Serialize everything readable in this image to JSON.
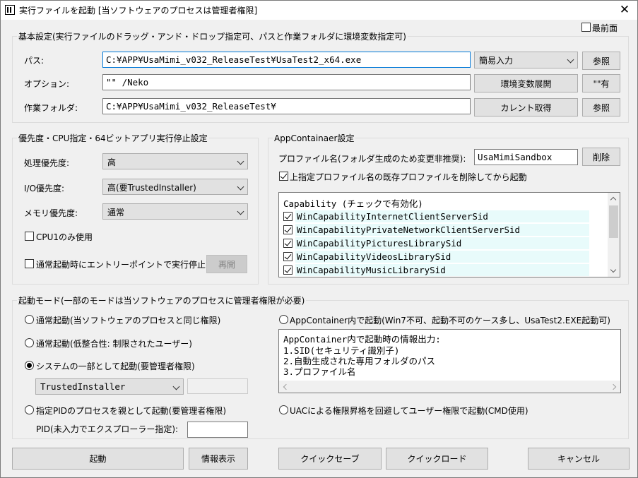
{
  "window": {
    "title": "実行ファイルを起動 [当ソフトウェアのプロセスは管理者権限]",
    "close_glyph": "✕"
  },
  "topmost": {
    "label": "最前面",
    "checked": false
  },
  "basic": {
    "title": "基本設定(実行ファイルのドラッグ・アンド・ドロップ指定可、パスと作業フォルダに環境変数指定可)",
    "path_label": "パス:",
    "path_value": "C:¥APP¥UsaMimi_v032_ReleaseTest¥UsaTest2_x64.exe",
    "input_mode": "簡易入力",
    "browse1": "参照",
    "option_label": "オプション:",
    "option_value": "\"\" /Neko",
    "expand_env": "環境変数展開",
    "quote_button": "\"\"有",
    "workdir_label": "作業フォルダ:",
    "workdir_value": "C:¥APP¥UsaMimi_v032_ReleaseTest¥",
    "get_current": "カレント取得",
    "browse2": "参照"
  },
  "priority": {
    "title": "優先度・CPU指定・64ビットアプリ実行停止設定",
    "process_label": "処理優先度:",
    "process_value": "高",
    "io_label": "I/O優先度:",
    "io_value": "高(要TrustedInstaller)",
    "memory_label": "メモリ優先度:",
    "memory_value": "通常",
    "cpu1_label": "CPU1のみ使用",
    "cpu1_checked": false,
    "entry_stop_label": "通常起動時にエントリーポイントで実行停止",
    "entry_stop_checked": false,
    "resume": "再開"
  },
  "appcontainer": {
    "title": "AppContainaer設定",
    "profile_label": "プロファイル名(フォルダ生成のため変更非推奨):",
    "profile_value": "UsaMimiSandbox",
    "delete": "削除",
    "delete_existing_label": "上指定プロファイル名の既存プロファイルを削除してから起動",
    "delete_existing_checked": true,
    "capability_header": "Capability (チェックで有効化)",
    "capabilities": [
      {
        "name": "WinCapabilityInternetClientServerSid",
        "checked": true
      },
      {
        "name": "WinCapabilityPrivateNetworkClientServerSid",
        "checked": true
      },
      {
        "name": "WinCapabilityPicturesLibrarySid",
        "checked": true
      },
      {
        "name": "WinCapabilityVideosLibrarySid",
        "checked": true
      },
      {
        "name": "WinCapabilityMusicLibrarySid",
        "checked": true
      }
    ]
  },
  "mode": {
    "title": "起動モード(一部のモードは当ソフトウェアのプロセスに管理者権限が必要)",
    "normal_same": "通常起動(当ソフトウェアのプロセスと同じ権限)",
    "normal_low": "通常起動(低整合性: 制限されたユーザー)",
    "system_part": "システムの一部として起動(要管理者権限)",
    "system_account": "TrustedInstaller",
    "pid_parent": "指定PIDのプロセスを親として起動(要管理者権限)",
    "pid_label": "PID(未入力でエクスプローラー指定):",
    "pid_value": "",
    "appcontainer_mode": "AppContainer内で起動(Win7不可、起動不可のケース多し、UsaTest2.EXE起動可)",
    "uac_bypass": "UACによる権限昇格を回避してユーザー権限で起動(CMD使用)",
    "selected": "system_part",
    "info_lines": [
      "AppContainer内で起動時の情報出力:",
      "1.SID(セキュリティ識別子)",
      "2.自動生成された専用フォルダのパス",
      "3.プロファイル名"
    ]
  },
  "footer": {
    "launch": "起動",
    "info": "情報表示",
    "quick_save": "クイックセーブ",
    "quick_load": "クイックロード",
    "cancel": "キャンセル"
  }
}
